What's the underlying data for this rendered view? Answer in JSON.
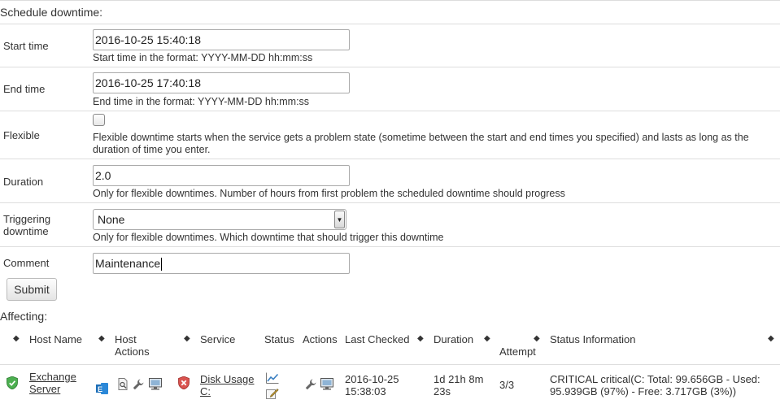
{
  "form": {
    "title": "Schedule downtime:",
    "start_time": {
      "label": "Start time",
      "value": "2016-10-25 15:40:18",
      "help": "Start time in the format: YYYY-MM-DD hh:mm:ss"
    },
    "end_time": {
      "label": "End time",
      "value": "2016-10-25 17:40:18",
      "help": "End time in the format: YYYY-MM-DD hh:mm:ss"
    },
    "flexible": {
      "label": "Flexible",
      "checked": false,
      "help": "Flexible downtime starts when the service gets a problem state (sometime between the start and end times you specified) and lasts as long as the duration of time you enter."
    },
    "duration": {
      "label": "Duration",
      "value": "2.0",
      "help": "Only for flexible downtimes. Number of hours from first problem the scheduled downtime should progress"
    },
    "triggering": {
      "label_line1": "Triggering",
      "label_line2": "downtime",
      "selected": "None",
      "help": "Only for flexible downtimes. Which downtime that should trigger this downtime"
    },
    "comment": {
      "label": "Comment",
      "value": "Maintenance"
    },
    "submit_label": "Submit"
  },
  "affecting": {
    "title": "Affecting:",
    "columns": {
      "host_name": "Host Name",
      "host_actions_line1": "Host",
      "host_actions_line2": "Actions",
      "service": "Service",
      "status": "Status",
      "actions": "Actions",
      "last_checked": "Last Checked",
      "duration": "Duration",
      "attempt": "Attempt",
      "status_information": "Status Information"
    },
    "row": {
      "host_line1": "Exchange",
      "host_line2": "Server",
      "host_state": "ok",
      "service_line1": "Disk Usage",
      "service_line2": "C:",
      "service_state": "critical",
      "last_checked_line1": "2016-10-25",
      "last_checked_line2": "15:38:03",
      "duration_line1": "1d 21h 8m",
      "duration_line2": "23s",
      "attempt": "3/3",
      "status_info_line1": "CRITICAL critical(C: Total: 99.656GB - Used:",
      "status_info_line2": "95.939GB (97%) - Free: 3.717GB (3%))"
    },
    "icons": {
      "host_status": "shield-check-icon",
      "host_app": "exchange-icon",
      "host_actions": [
        "page-search-icon",
        "wrench-icon",
        "monitor-icon"
      ],
      "service_status": "shield-x-icon",
      "service_status_actions": [
        "graph-icon",
        "edit-icon"
      ],
      "service_actions": [
        "wrench-icon",
        "monitor-icon"
      ]
    },
    "colors": {
      "ok": "#4caf50",
      "critical": "#d9534f",
      "exchange": "#1d6fb8"
    }
  }
}
